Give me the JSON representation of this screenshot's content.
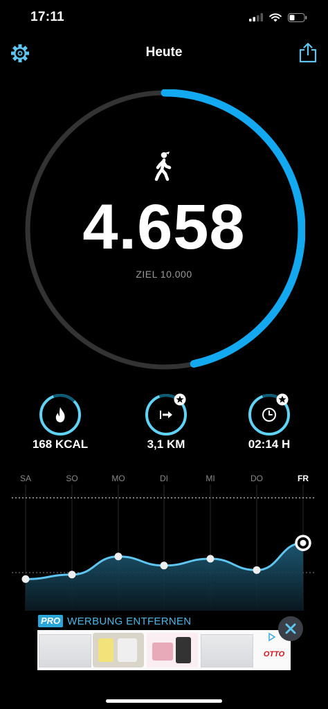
{
  "status_bar": {
    "time": "17:11"
  },
  "header": {
    "title": "Heute"
  },
  "steps": {
    "value": "4.658",
    "goal_label": "ZIEL 10.000",
    "progress": 0.4658
  },
  "metrics": [
    {
      "value_label": "168 KCAL",
      "icon": "flame-icon",
      "progress": 0.8
    },
    {
      "value_label": "3,1 KM",
      "icon": "distance-arrow-icon",
      "progress": 0.8
    },
    {
      "value_label": "02:14 H",
      "icon": "clock-icon",
      "progress": 0.8
    }
  ],
  "chart_data": {
    "type": "area",
    "categories": [
      "SA",
      "SO",
      "MO",
      "DI",
      "MI",
      "DO",
      "FR"
    ],
    "values": [
      0.28,
      0.32,
      0.48,
      0.4,
      0.46,
      0.36,
      0.6
    ],
    "ylim": [
      0,
      1
    ],
    "selected_index": 6,
    "colors": {
      "line": "#5ec5f0",
      "fill_top": "#1f5f7c",
      "fill_bottom": "#0a1a22"
    }
  },
  "ad": {
    "pro_badge": "PRO",
    "remove_label": "WERBUNG ENTFERNEN",
    "brand": "OTTO"
  },
  "colors": {
    "accent": "#13a9f0",
    "track": "#333333",
    "metric_ring": "#5fd3f5"
  }
}
